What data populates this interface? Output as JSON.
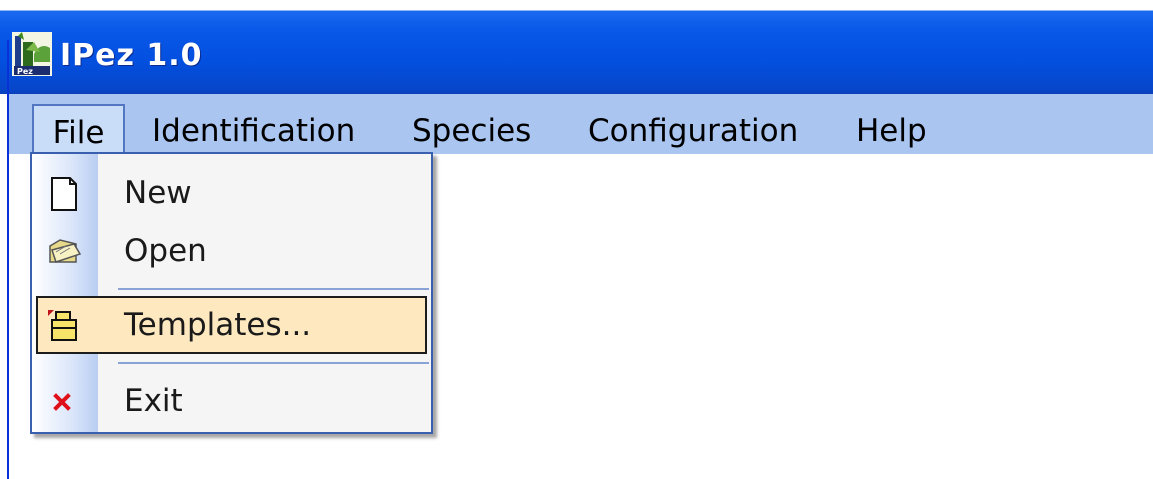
{
  "window": {
    "title": "IPez 1.0",
    "title_color": "#0a58e8"
  },
  "menubar": {
    "items": [
      {
        "label": "File"
      },
      {
        "label": "Identification"
      },
      {
        "label": "Species"
      },
      {
        "label": "Configuration"
      },
      {
        "label": "Help"
      }
    ]
  },
  "file_menu": {
    "items": [
      {
        "label": "New",
        "icon": "new-document-icon"
      },
      {
        "label": "Open",
        "icon": "open-folder-icon"
      },
      {
        "label": "Templates...",
        "icon": "templates-icon",
        "highlighted": true
      },
      {
        "label": "Exit",
        "icon": "exit-x-icon"
      }
    ],
    "highlight_color": "#fde8c0"
  }
}
